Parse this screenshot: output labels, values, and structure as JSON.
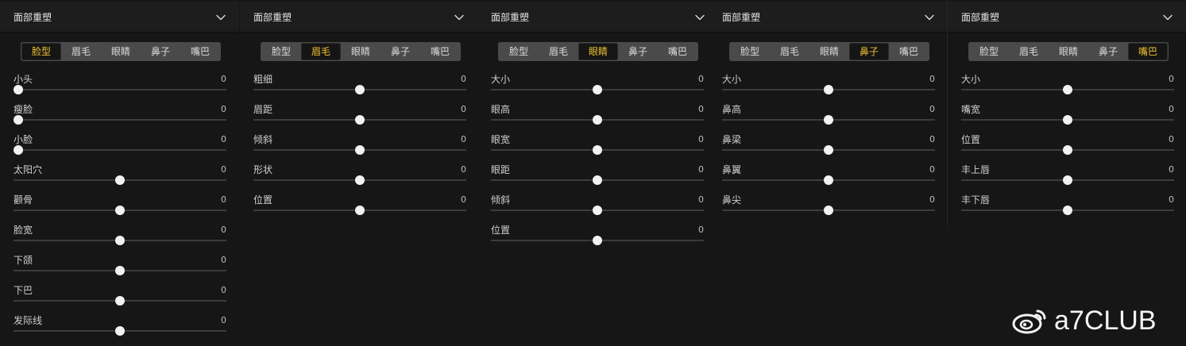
{
  "panels": [
    {
      "title": "面部重塑",
      "tabs": [
        "脸型",
        "眉毛",
        "眼睛",
        "鼻子",
        "嘴巴"
      ],
      "active_tab": 0,
      "sliders": [
        {
          "label": "小头",
          "value": "0",
          "position": 0
        },
        {
          "label": "瘦脸",
          "value": "0",
          "position": 0
        },
        {
          "label": "小脸",
          "value": "0",
          "position": 0
        },
        {
          "label": "太阳穴",
          "value": "0",
          "position": 0.5
        },
        {
          "label": "颧骨",
          "value": "0",
          "position": 0.5
        },
        {
          "label": "脸宽",
          "value": "0",
          "position": 0.5
        },
        {
          "label": "下颌",
          "value": "0",
          "position": 0.5
        },
        {
          "label": "下巴",
          "value": "0",
          "position": 0.5
        },
        {
          "label": "发际线",
          "value": "0",
          "position": 0.5
        }
      ]
    },
    {
      "title": "面部重塑",
      "tabs": [
        "脸型",
        "眉毛",
        "眼睛",
        "鼻子",
        "嘴巴"
      ],
      "active_tab": 1,
      "sliders": [
        {
          "label": "粗细",
          "value": "0",
          "position": 0.5
        },
        {
          "label": "眉距",
          "value": "0",
          "position": 0.5
        },
        {
          "label": "倾斜",
          "value": "0",
          "position": 0.5
        },
        {
          "label": "形状",
          "value": "0",
          "position": 0.5
        },
        {
          "label": "位置",
          "value": "0",
          "position": 0.5
        }
      ]
    },
    {
      "title": "面部重塑",
      "tabs": [
        "脸型",
        "眉毛",
        "眼睛",
        "鼻子",
        "嘴巴"
      ],
      "active_tab": 2,
      "sliders": [
        {
          "label": "大小",
          "value": "0",
          "position": 0.5
        },
        {
          "label": "眼高",
          "value": "0",
          "position": 0.5
        },
        {
          "label": "眼宽",
          "value": "0",
          "position": 0.5
        },
        {
          "label": "眼距",
          "value": "0",
          "position": 0.5
        },
        {
          "label": "倾斜",
          "value": "0",
          "position": 0.5
        },
        {
          "label": "位置",
          "value": "0",
          "position": 0.5
        }
      ]
    },
    {
      "title": "面部重塑",
      "tabs": [
        "脸型",
        "眉毛",
        "眼睛",
        "鼻子",
        "嘴巴"
      ],
      "active_tab": 3,
      "sliders": [
        {
          "label": "大小",
          "value": "0",
          "position": 0.5
        },
        {
          "label": "鼻高",
          "value": "0",
          "position": 0.5
        },
        {
          "label": "鼻梁",
          "value": "0",
          "position": 0.5
        },
        {
          "label": "鼻翼",
          "value": "0",
          "position": 0.5
        },
        {
          "label": "鼻尖",
          "value": "0",
          "position": 0.5
        }
      ]
    },
    {
      "title": "面部重塑",
      "tabs": [
        "脸型",
        "眉毛",
        "眼睛",
        "鼻子",
        "嘴巴"
      ],
      "active_tab": 4,
      "sliders": [
        {
          "label": "大小",
          "value": "0",
          "position": 0.5
        },
        {
          "label": "嘴宽",
          "value": "0",
          "position": 0.5
        },
        {
          "label": "位置",
          "value": "0",
          "position": 0.5
        },
        {
          "label": "丰上唇",
          "value": "0",
          "position": 0.5
        },
        {
          "label": "丰下唇",
          "value": "0",
          "position": 0.5
        }
      ]
    }
  ],
  "icons": {
    "collapse": "chevron-down-icon",
    "watermark": "weibo-logo-icon"
  },
  "colors": {
    "background": "#161616",
    "accent": "#f0c030",
    "thumb": "#f2f2f2"
  },
  "watermark": {
    "text": "a7CLUB"
  }
}
